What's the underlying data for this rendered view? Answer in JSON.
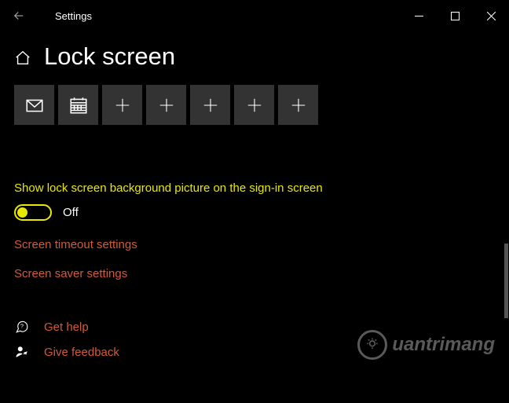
{
  "titlebar": {
    "title": "Settings"
  },
  "header": {
    "title": "Lock screen"
  },
  "tiles": {
    "icons": [
      "mail-icon",
      "calendar-icon",
      "plus-icon",
      "plus-icon",
      "plus-icon",
      "plus-icon",
      "plus-icon"
    ]
  },
  "option": {
    "label": "Show lock screen background picture on the sign-in screen",
    "state": "Off"
  },
  "links": {
    "timeout": "Screen timeout settings",
    "saver": "Screen saver settings"
  },
  "footer": {
    "help": "Get help",
    "feedback": "Give feedback"
  },
  "watermark": {
    "text": "uantrimang"
  }
}
